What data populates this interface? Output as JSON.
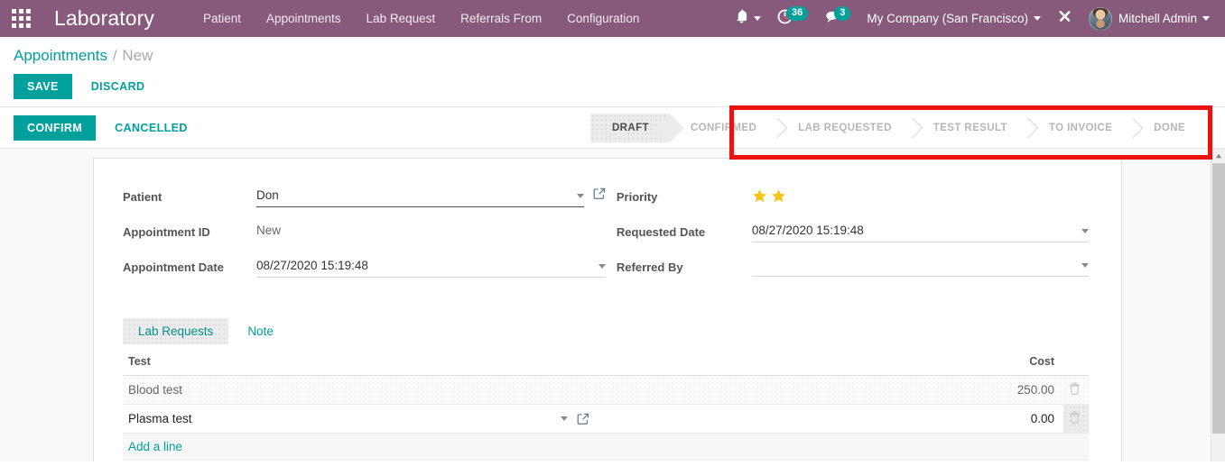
{
  "navbar": {
    "apps_icon": "apps-grid-icon",
    "brand": "Laboratory",
    "menu": [
      {
        "label": "Patient"
      },
      {
        "label": "Appointments"
      },
      {
        "label": "Lab Request"
      },
      {
        "label": "Referrals From"
      },
      {
        "label": "Configuration"
      }
    ],
    "bell_icon": "bell-icon",
    "activity_icon": "clock-activity-icon",
    "activity_count": "36",
    "messages_icon": "messages-icon",
    "messages_count": "3",
    "company": "My Company (San Francisco)",
    "debug_icon": "wrench-tools-icon",
    "user": "Mitchell Admin",
    "avatar": "user-avatar"
  },
  "breadcrumb": {
    "root": "Appointments",
    "separator": "/",
    "current": "New"
  },
  "actions": {
    "save": "SAVE",
    "discard": "DISCARD"
  },
  "workflow": {
    "confirm": "CONFIRM",
    "cancelled": "CANCELLED"
  },
  "statusbar": {
    "stages": [
      {
        "label": "DRAFT",
        "active": true
      },
      {
        "label": "CONFIRMED",
        "active": false
      },
      {
        "label": "LAB REQUESTED",
        "active": false
      },
      {
        "label": "TEST RESULT",
        "active": false
      },
      {
        "label": "TO INVOICE",
        "active": false
      },
      {
        "label": "DONE",
        "active": false
      }
    ],
    "highlight_color": "#ee1111"
  },
  "form": {
    "left": {
      "patient_label": "Patient",
      "patient_value": "Don",
      "appointment_id_label": "Appointment ID",
      "appointment_id_value": "New",
      "appointment_date_label": "Appointment Date",
      "appointment_date_value": "08/27/2020 15:19:48"
    },
    "right": {
      "priority_label": "Priority",
      "priority_stars": 2,
      "priority_max": 2,
      "requested_date_label": "Requested Date",
      "requested_date_value": "08/27/2020 15:19:48",
      "referred_by_label": "Referred By",
      "referred_by_value": ""
    }
  },
  "notebook": {
    "tabs": [
      {
        "label": "Lab Requests",
        "active": true
      },
      {
        "label": "Note",
        "active": false
      }
    ],
    "columns": {
      "test": "Test",
      "cost": "Cost"
    },
    "rows": [
      {
        "test": "Blood test",
        "cost": "250.00",
        "editing": false
      },
      {
        "test": "Plasma test",
        "cost": "0.00",
        "editing": true
      }
    ],
    "add_line": "Add a line"
  },
  "colors": {
    "brand_purple": "#875A7B",
    "accent_teal": "#00A09D",
    "star_gold": "#F0C419",
    "highlight_red": "#ee1111"
  }
}
